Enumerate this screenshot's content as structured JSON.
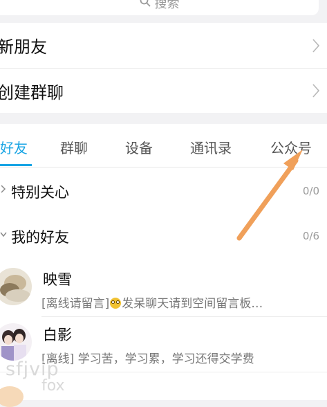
{
  "search": {
    "placeholder": "搜索"
  },
  "menu": {
    "new_friends": "新朋友",
    "create_group": "创建群聊"
  },
  "tabs": [
    {
      "label": "好友",
      "active": true
    },
    {
      "label": "群聊",
      "active": false
    },
    {
      "label": "设备",
      "active": false
    },
    {
      "label": "通讯录",
      "active": false
    },
    {
      "label": "公众号",
      "active": false
    }
  ],
  "groups": [
    {
      "name": "特别关心",
      "count": "0/0"
    },
    {
      "name": "我的好友",
      "count": "0/6"
    }
  ],
  "friends": [
    {
      "name": "映雪",
      "status_prefix": "[离线请留言]",
      "status_text": "发呆聊天请到空间留言板…"
    },
    {
      "name": "白影",
      "status_prefix": "[离线]",
      "status_text": " 学习苦，学习累，学习还得交学费"
    }
  ],
  "watermark": {
    "line1": "sfjvip",
    "line2": "fox"
  },
  "colors": {
    "accent": "#17a4e4",
    "annotation_arrow": "#f0a05a"
  }
}
